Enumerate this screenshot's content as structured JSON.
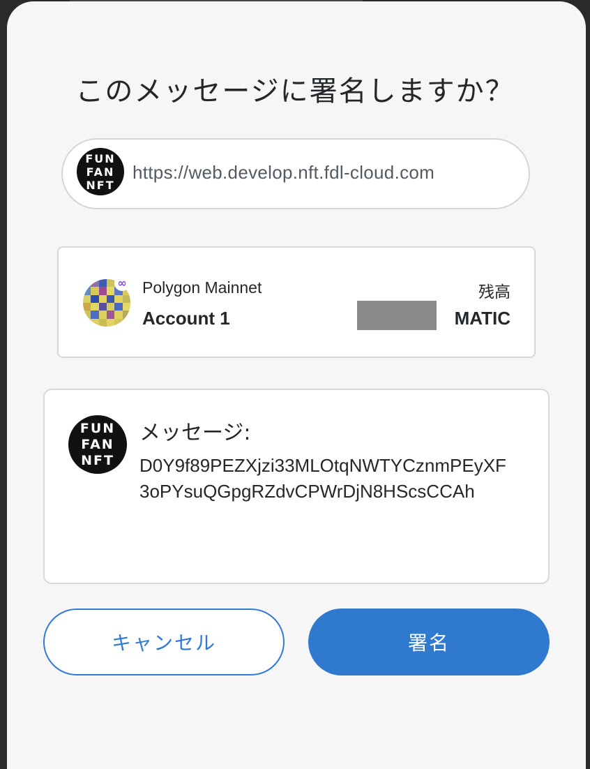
{
  "dialog": {
    "title": "このメッセージに署名しますか？"
  },
  "origin": {
    "logo_lines": [
      "FUN",
      "FAN",
      "NFT"
    ],
    "url": "https://web.develop.nft.fdl-cloud.com"
  },
  "account": {
    "network": "Polygon Mainnet",
    "network_icon": "polygon-icon",
    "name": "Account 1",
    "balance_label": "残高",
    "balance_unit": "MATIC"
  },
  "message": {
    "logo_lines": [
      "FUN",
      "FAN",
      "NFT"
    ],
    "label": "メッセージ:",
    "body": "D0Y9f89PEZXjzi33MLOtqNWTYCznmPEyXF3oPYsuQGpgRZdvCPWrDjN8HScsCCAh"
  },
  "buttons": {
    "cancel_label": "キャンセル",
    "sign_label": "署名"
  },
  "colors": {
    "primary": "#2f79cf",
    "sheet": "#f6f6f6",
    "text": "#24272a",
    "border": "#d6d9dc"
  }
}
